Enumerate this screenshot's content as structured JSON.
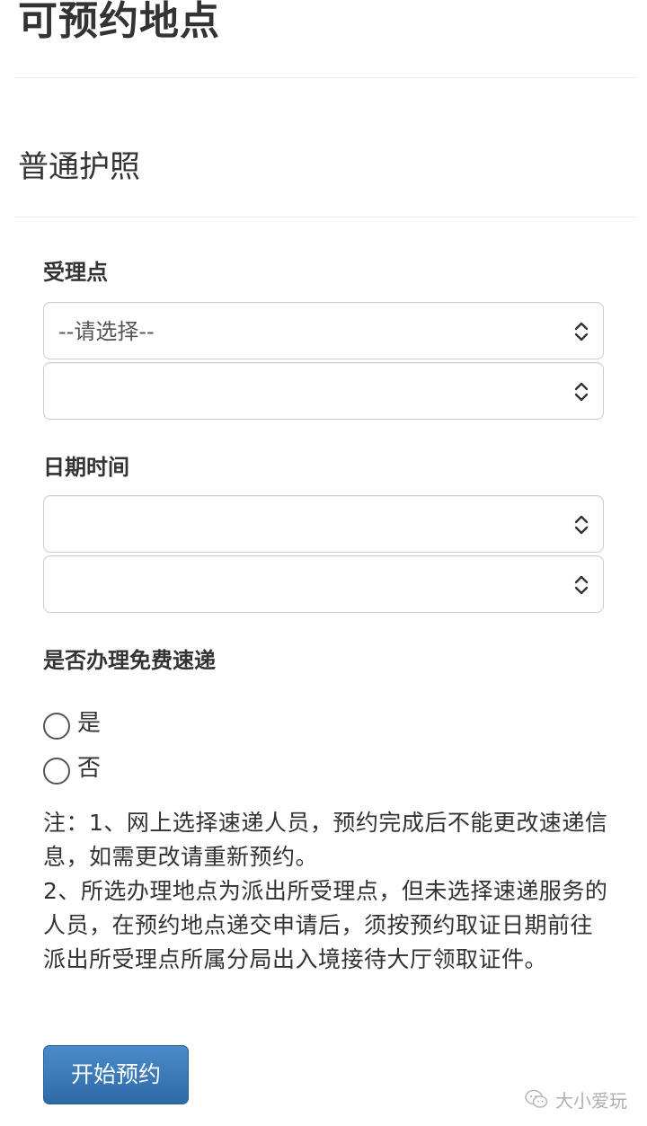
{
  "page": {
    "title": "可预约地点"
  },
  "section": {
    "title": "普通护照"
  },
  "form": {
    "acceptance_point": {
      "label": "受理点",
      "select1_value": "--请选择--",
      "select2_value": ""
    },
    "datetime": {
      "label": "日期时间",
      "select1_value": "",
      "select2_value": ""
    },
    "free_delivery": {
      "label": "是否办理免费速递",
      "options": [
        "是",
        "否"
      ]
    },
    "note": {
      "line1": "注：1、网上选择速递人员，预约完成后不能更改速递信息，如需更改请重新预约。",
      "line2": "2、所选办理地点为派出所受理点，但未选择速递服务的人员，在预约地点递交申请后，须按预约取证日期前往派出所受理点所属分局出入境接待大厅领取证件。"
    },
    "submit_label": "开始预约"
  },
  "watermark": {
    "text": "大小爱玩"
  },
  "icons": {
    "select_chevron": "updown-chevron-icon",
    "watermark_icon": "wechat-icon"
  },
  "colors": {
    "button_bg": "#3a78b8",
    "border": "#cccccc"
  }
}
